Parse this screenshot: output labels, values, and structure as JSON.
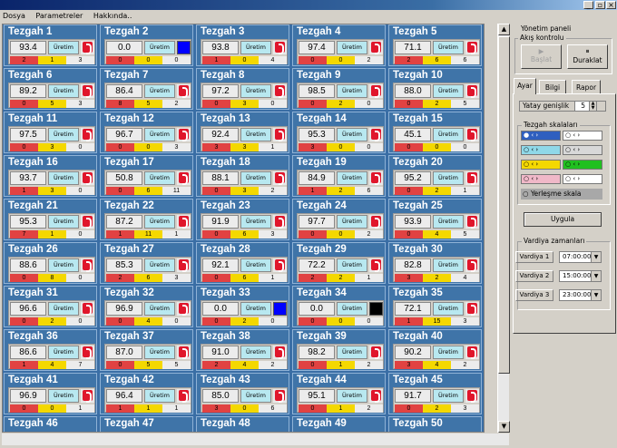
{
  "menu": [
    "Dosya",
    "Parametreler",
    "Hakkında.."
  ],
  "colors": {
    "red": "#e14242",
    "yellow": "#f4d800",
    "tile_bg": "#3f74a8"
  },
  "machines": [
    {
      "name": "Tezgah 1",
      "value": "93.4",
      "status": "Üretim",
      "indicator": "logo",
      "counts": [
        "2",
        "1",
        "3"
      ]
    },
    {
      "name": "Tezgah 2",
      "value": "0.0",
      "status": "Üretim",
      "indicator": "blue",
      "counts": [
        "0",
        "0",
        "0"
      ]
    },
    {
      "name": "Tezgah 3",
      "value": "93.8",
      "status": "Üretim",
      "indicator": "logo",
      "counts": [
        "1",
        "0",
        "4"
      ]
    },
    {
      "name": "Tezgah 4",
      "value": "97.4",
      "status": "Üretim",
      "indicator": "logo",
      "counts": [
        "0",
        "0",
        "2"
      ]
    },
    {
      "name": "Tezgah 5",
      "value": "71.1",
      "status": "Üretim",
      "indicator": "logo",
      "counts": [
        "2",
        "6",
        "6"
      ]
    },
    {
      "name": "Tezgah 6",
      "value": "89.2",
      "status": "Üretim",
      "indicator": "logo",
      "counts": [
        "0",
        "5",
        "3"
      ]
    },
    {
      "name": "Tezgah 7",
      "value": "86.4",
      "status": "Üretim",
      "indicator": "logo",
      "counts": [
        "8",
        "5",
        "2"
      ]
    },
    {
      "name": "Tezgah 8",
      "value": "97.2",
      "status": "Üretim",
      "indicator": "logo",
      "counts": [
        "0",
        "3",
        "0"
      ]
    },
    {
      "name": "Tezgah 9",
      "value": "98.5",
      "status": "Üretim",
      "indicator": "logo",
      "counts": [
        "0",
        "2",
        "0"
      ]
    },
    {
      "name": "Tezgah 10",
      "value": "88.0",
      "status": "Üretim",
      "indicator": "logo",
      "counts": [
        "0",
        "2",
        "5"
      ]
    },
    {
      "name": "Tezgah 11",
      "value": "97.5",
      "status": "Üretim",
      "indicator": "logo",
      "counts": [
        "0",
        "3",
        "0"
      ]
    },
    {
      "name": "Tezgah 12",
      "value": "96.7",
      "status": "Üretim",
      "indicator": "logo",
      "counts": [
        "0",
        "0",
        "3"
      ]
    },
    {
      "name": "Tezgah 13",
      "value": "92.4",
      "status": "Üretim",
      "indicator": "logo",
      "counts": [
        "3",
        "3",
        "1"
      ]
    },
    {
      "name": "Tezgah 14",
      "value": "95.3",
      "status": "Üretim",
      "indicator": "logo",
      "counts": [
        "3",
        "0",
        "0"
      ]
    },
    {
      "name": "Tezgah 15",
      "value": "45.1",
      "status": "Üretim",
      "indicator": "logo",
      "counts": [
        "0",
        "0",
        "0"
      ]
    },
    {
      "name": "Tezgah 16",
      "value": "93.7",
      "status": "Üretim",
      "indicator": "logo",
      "counts": [
        "1",
        "3",
        "0"
      ]
    },
    {
      "name": "Tezgah 17",
      "value": "50.8",
      "status": "Üretim",
      "indicator": "logo",
      "counts": [
        "0",
        "6",
        "11"
      ]
    },
    {
      "name": "Tezgah 18",
      "value": "88.1",
      "status": "Üretim",
      "indicator": "logo",
      "counts": [
        "0",
        "3",
        "2"
      ]
    },
    {
      "name": "Tezgah 19",
      "value": "84.9",
      "status": "Üretim",
      "indicator": "logo",
      "counts": [
        "1",
        "2",
        "6"
      ]
    },
    {
      "name": "Tezgah 20",
      "value": "95.2",
      "status": "Üretim",
      "indicator": "logo",
      "counts": [
        "0",
        "2",
        "1"
      ]
    },
    {
      "name": "Tezgah 21",
      "value": "95.3",
      "status": "Üretim",
      "indicator": "logo",
      "counts": [
        "7",
        "1",
        "0"
      ]
    },
    {
      "name": "Tezgah 22",
      "value": "87.2",
      "status": "Üretim",
      "indicator": "logo",
      "counts": [
        "1",
        "11",
        "1"
      ]
    },
    {
      "name": "Tezgah 23",
      "value": "91.9",
      "status": "Üretim",
      "indicator": "logo",
      "counts": [
        "0",
        "6",
        "3"
      ]
    },
    {
      "name": "Tezgah 24",
      "value": "97.7",
      "status": "Üretim",
      "indicator": "logo",
      "counts": [
        "0",
        "0",
        "2"
      ]
    },
    {
      "name": "Tezgah 25",
      "value": "93.9",
      "status": "Üretim",
      "indicator": "logo",
      "counts": [
        "0",
        "4",
        "5"
      ]
    },
    {
      "name": "Tezgah 26",
      "value": "88.6",
      "status": "Üretim",
      "indicator": "logo",
      "counts": [
        "0",
        "8",
        "0"
      ]
    },
    {
      "name": "Tezgah 27",
      "value": "85.3",
      "status": "Üretim",
      "indicator": "logo",
      "counts": [
        "2",
        "6",
        "3"
      ]
    },
    {
      "name": "Tezgah 28",
      "value": "92.1",
      "status": "Üretim",
      "indicator": "logo",
      "counts": [
        "0",
        "6",
        "1"
      ]
    },
    {
      "name": "Tezgah 29",
      "value": "72.2",
      "status": "Üretim",
      "indicator": "logo",
      "counts": [
        "2",
        "2",
        "1"
      ]
    },
    {
      "name": "Tezgah 30",
      "value": "82.8",
      "status": "Üretim",
      "indicator": "logo",
      "counts": [
        "3",
        "2",
        "4"
      ]
    },
    {
      "name": "Tezgah 31",
      "value": "96.6",
      "status": "Üretim",
      "indicator": "logo",
      "counts": [
        "0",
        "2",
        "0"
      ]
    },
    {
      "name": "Tezgah 32",
      "value": "96.9",
      "status": "Üretim",
      "indicator": "logo",
      "counts": [
        "0",
        "4",
        "0"
      ]
    },
    {
      "name": "Tezgah 33",
      "value": "0.0",
      "status": "Üretim",
      "indicator": "blue",
      "counts": [
        "0",
        "2",
        "0"
      ]
    },
    {
      "name": "Tezgah 34",
      "value": "0.0",
      "status": "Üretim",
      "indicator": "black",
      "counts": [
        "0",
        "0",
        "0"
      ]
    },
    {
      "name": "Tezgah 35",
      "value": "72.1",
      "status": "Üretim",
      "indicator": "logo",
      "counts": [
        "1",
        "15",
        "3"
      ]
    },
    {
      "name": "Tezgah 36",
      "value": "86.6",
      "status": "Üretim",
      "indicator": "logo",
      "counts": [
        "1",
        "4",
        "7"
      ]
    },
    {
      "name": "Tezgah 37",
      "value": "87.0",
      "status": "Üretim",
      "indicator": "logo",
      "counts": [
        "0",
        "5",
        "5"
      ]
    },
    {
      "name": "Tezgah 38",
      "value": "91.0",
      "status": "Üretim",
      "indicator": "logo",
      "counts": [
        "2",
        "4",
        "2"
      ]
    },
    {
      "name": "Tezgah 39",
      "value": "98.2",
      "status": "Üretim",
      "indicator": "logo",
      "counts": [
        "0",
        "1",
        "2"
      ]
    },
    {
      "name": "Tezgah 40",
      "value": "90.2",
      "status": "Üretim",
      "indicator": "logo",
      "counts": [
        "3",
        "4",
        "2"
      ]
    },
    {
      "name": "Tezgah 41",
      "value": "96.9",
      "status": "Üretim",
      "indicator": "logo",
      "counts": [
        "0",
        "0",
        "1"
      ]
    },
    {
      "name": "Tezgah 42",
      "value": "96.4",
      "status": "Üretim",
      "indicator": "logo",
      "counts": [
        "1",
        "1",
        "1"
      ]
    },
    {
      "name": "Tezgah 43",
      "value": "85.0",
      "status": "Üretim",
      "indicator": "logo",
      "counts": [
        "3",
        "0",
        "6"
      ]
    },
    {
      "name": "Tezgah 44",
      "value": "95.1",
      "status": "Üretim",
      "indicator": "logo",
      "counts": [
        "0",
        "1",
        "2"
      ]
    },
    {
      "name": "Tezgah 45",
      "value": "91.7",
      "status": "Üretim",
      "indicator": "logo",
      "counts": [
        "0",
        "2",
        "3"
      ]
    },
    {
      "name": "Tezgah 46",
      "value": "",
      "status": "",
      "indicator": "none",
      "counts": [
        "",
        "",
        ""
      ]
    },
    {
      "name": "Tezgah 47",
      "value": "",
      "status": "",
      "indicator": "none",
      "counts": [
        "",
        "",
        ""
      ]
    },
    {
      "name": "Tezgah 48",
      "value": "",
      "status": "",
      "indicator": "none",
      "counts": [
        "",
        "",
        ""
      ]
    },
    {
      "name": "Tezgah 49",
      "value": "",
      "status": "",
      "indicator": "none",
      "counts": [
        "",
        "",
        ""
      ]
    },
    {
      "name": "Tezgah 50",
      "value": "",
      "status": "",
      "indicator": "none",
      "counts": [
        "",
        "",
        ""
      ]
    }
  ],
  "panel": {
    "title": "Yönetim paneli",
    "flow_group": "Akış kontrolu",
    "start_label": "Başlat",
    "pause_label": "Duraklat",
    "tabs": [
      "Ayar",
      "Bilgi",
      "Rapor"
    ],
    "horizontal_width_label": "Yatay genişlik",
    "horizontal_width_value": "5",
    "scales_group": "Tezgah skalaları",
    "placement_scale_label": "Yerleşme skala",
    "apply_label": "Uygula",
    "shift_group": "Vardiya zamanları",
    "shifts": [
      {
        "label": "Vardiya 1",
        "time": "07:00:00"
      },
      {
        "label": "Vardiya 2",
        "time": "15:00:00"
      },
      {
        "label": "Vardiya 3",
        "time": "23:00:00"
      }
    ]
  }
}
